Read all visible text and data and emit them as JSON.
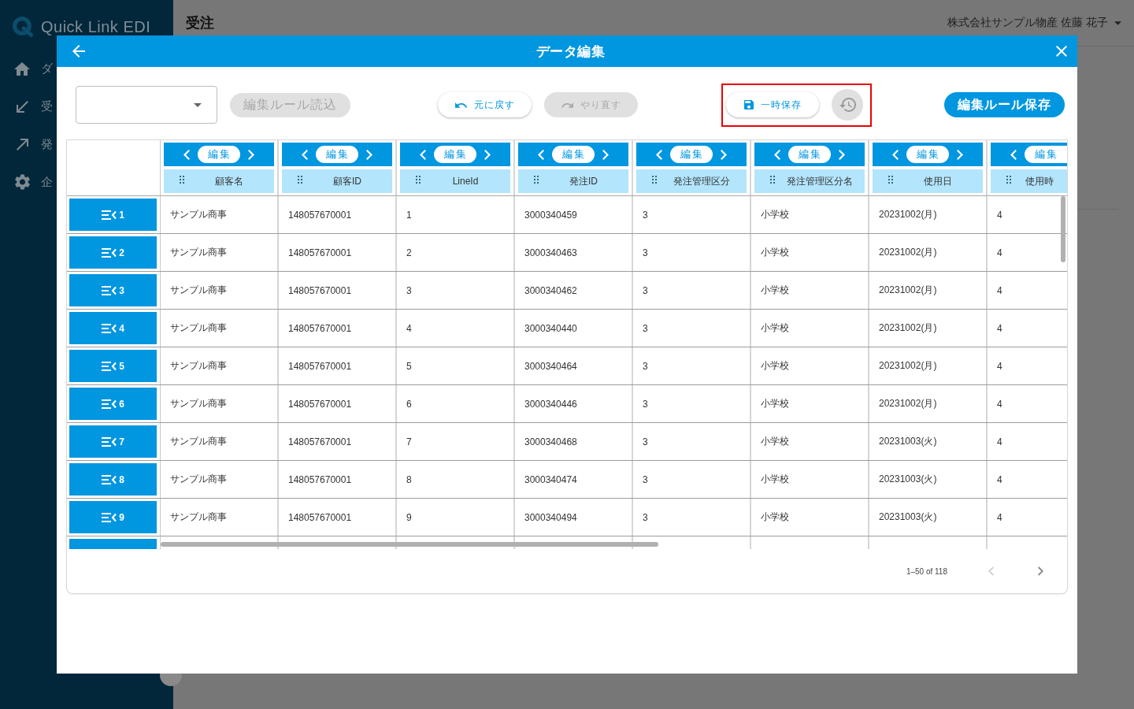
{
  "sidebar": {
    "logo": "Quick Link EDI",
    "items": [
      {
        "label": "ダ"
      },
      {
        "label": "受"
      },
      {
        "label": "発"
      },
      {
        "label": "企"
      }
    ]
  },
  "header": {
    "title": "受注",
    "user": "株式会社サンプル物産 佐藤 花子"
  },
  "dialog": {
    "title": "データ編集",
    "toolbar": {
      "load_rule": {
        "label": "編集ルール読込",
        "disabled": true
      },
      "undo": {
        "label": "元に戻す",
        "disabled": false
      },
      "redo": {
        "label": "やり直す",
        "disabled": true
      },
      "save_group": {
        "highlighted": true,
        "temp_save": {
          "label": "一時保存",
          "disabled": false
        },
        "history": {
          "disabled": true
        }
      },
      "save_rule": {
        "label": "編集ルール保存"
      }
    },
    "table": {
      "columns": [
        {
          "edit_label": "編集",
          "name": "顧客名"
        },
        {
          "edit_label": "編集",
          "name": "顧客ID"
        },
        {
          "edit_label": "編集",
          "name": "LineId"
        },
        {
          "edit_label": "編集",
          "name": "発注ID"
        },
        {
          "edit_label": "編集",
          "name": "発注管理区分"
        },
        {
          "edit_label": "編集",
          "name": "発注管理区分名"
        },
        {
          "edit_label": "編集",
          "name": "使用日"
        },
        {
          "edit_label": "編集",
          "name": "使用時"
        }
      ],
      "rows": [
        {
          "number": "1",
          "cells": [
            "サンプル商事",
            "148057670001",
            "1",
            "3000340459",
            "3",
            "小学校",
            "20231002(月)",
            "4"
          ]
        },
        {
          "number": "2",
          "cells": [
            "サンプル商事",
            "148057670001",
            "2",
            "3000340463",
            "3",
            "小学校",
            "20231002(月)",
            "4"
          ]
        },
        {
          "number": "3",
          "cells": [
            "サンプル商事",
            "148057670001",
            "3",
            "3000340462",
            "3",
            "小学校",
            "20231002(月)",
            "4"
          ]
        },
        {
          "number": "4",
          "cells": [
            "サンプル商事",
            "148057670001",
            "4",
            "3000340440",
            "3",
            "小学校",
            "20231002(月)",
            "4"
          ]
        },
        {
          "number": "5",
          "cells": [
            "サンプル商事",
            "148057670001",
            "5",
            "3000340464",
            "3",
            "小学校",
            "20231002(月)",
            "4"
          ]
        },
        {
          "number": "6",
          "cells": [
            "サンプル商事",
            "148057670001",
            "6",
            "3000340446",
            "3",
            "小学校",
            "20231002(月)",
            "4"
          ]
        },
        {
          "number": "7",
          "cells": [
            "サンプル商事",
            "148057670001",
            "7",
            "3000340468",
            "3",
            "小学校",
            "20231003(火)",
            "4"
          ]
        },
        {
          "number": "8",
          "cells": [
            "サンプル商事",
            "148057670001",
            "8",
            "3000340474",
            "3",
            "小学校",
            "20231003(火)",
            "4"
          ]
        },
        {
          "number": "9",
          "cells": [
            "サンプル商事",
            "148057670001",
            "9",
            "3000340494",
            "3",
            "小学校",
            "20231003(火)",
            "4"
          ]
        }
      ]
    },
    "pagination": {
      "range": "1–50 of 118",
      "prev": {
        "disabled": true
      },
      "next": {
        "disabled": false
      }
    }
  }
}
